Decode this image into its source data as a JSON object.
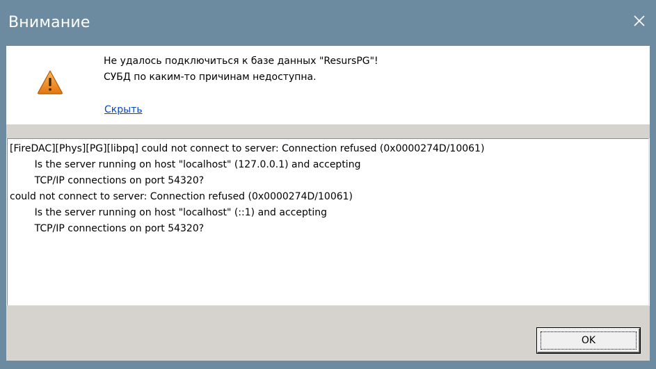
{
  "window": {
    "title": "Внимание",
    "close_icon": "close-icon"
  },
  "message": {
    "icon": "warning-icon",
    "line1": "Не удалось подключиться к базе данных \"ResursPG\"!",
    "line2": "СУБД по каким-то причинам недоступна.",
    "hide_link": "Скрыть"
  },
  "details": {
    "text": "[FireDAC][Phys][PG][libpq] could not connect to server: Connection refused (0x0000274D/10061)\n\tIs the server running on host \"localhost\" (127.0.0.1) and accepting\n\tTCP/IP connections on port 54320?\ncould not connect to server: Connection refused (0x0000274D/10061)\n\tIs the server running on host \"localhost\" (::1) and accepting\n\tTCP/IP connections on port 54320?"
  },
  "buttons": {
    "ok_label": "OK"
  },
  "colors": {
    "titlebar": "#6d8ba0",
    "link": "#0645c6",
    "warning_fill": "#f08a1c",
    "face": "#d6d3ce"
  }
}
